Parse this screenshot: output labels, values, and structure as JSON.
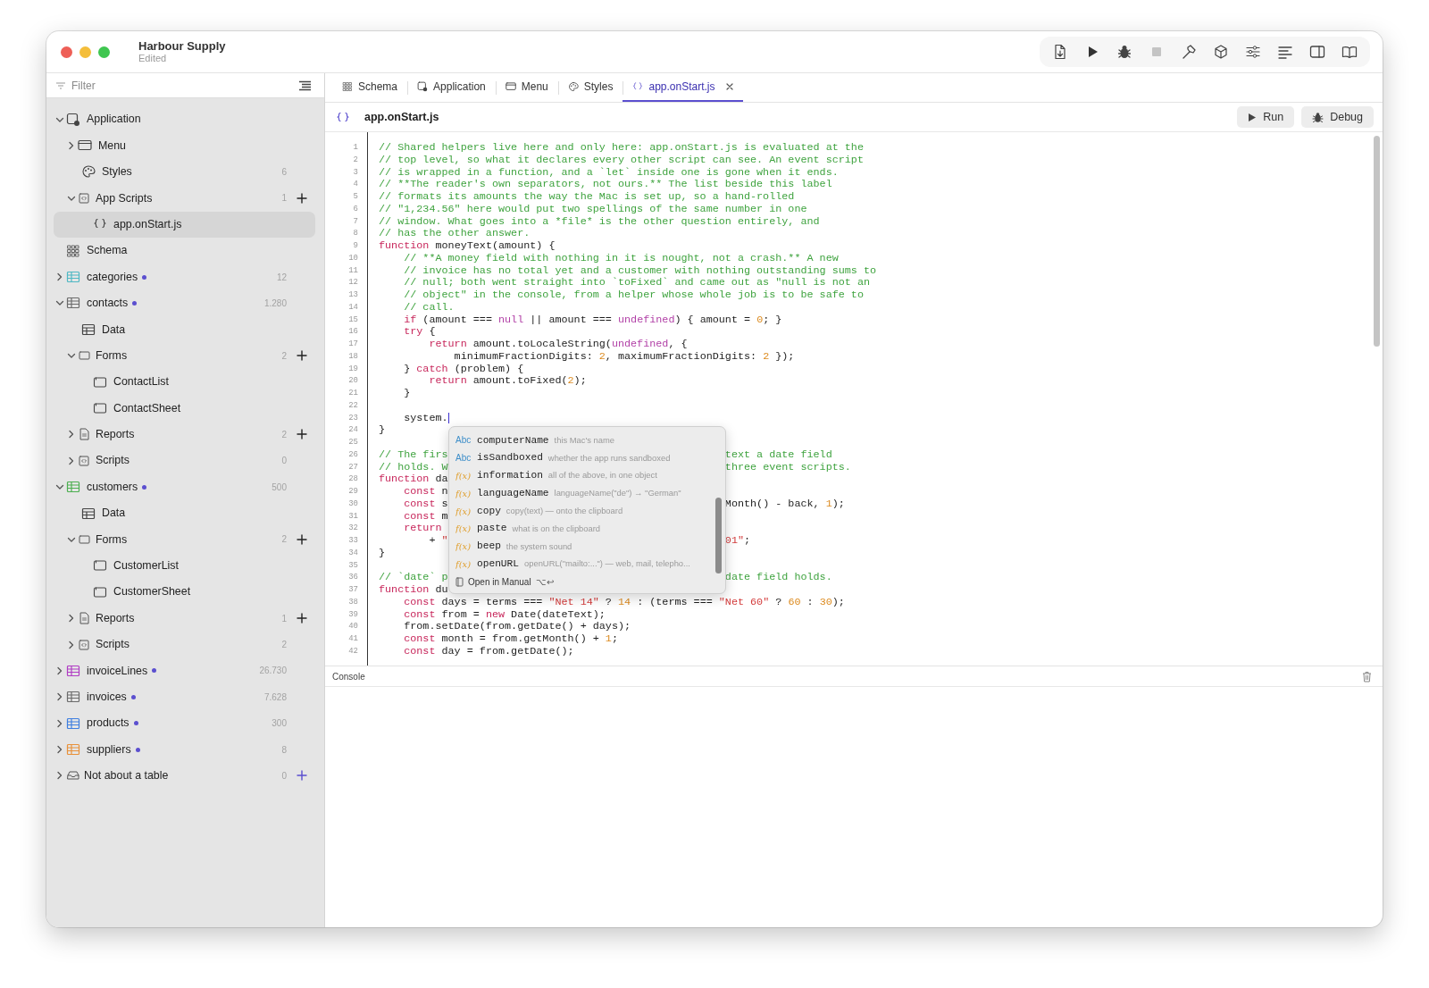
{
  "window": {
    "title": "Harbour Supply",
    "subtitle": "Edited"
  },
  "sidebar": {
    "filter": {
      "placeholder": "Filter"
    },
    "items": [
      {
        "label": "Application",
        "kind": "app",
        "expanded": true,
        "children": [
          {
            "label": "Menu",
            "kind": "window",
            "expanded": false
          },
          {
            "label": "Styles",
            "kind": "palette",
            "count": "6"
          },
          {
            "label": "App Scripts",
            "kind": "scripts",
            "expanded": true,
            "count": "1",
            "add": true,
            "children": [
              {
                "label": "app.onStart.js",
                "kind": "braces",
                "selected": true
              }
            ]
          }
        ]
      },
      {
        "label": "Schema",
        "kind": "schema"
      },
      {
        "label": "categories",
        "kind": "table",
        "color": "#4fb8c4",
        "unsaved": true,
        "expanded": false,
        "count": "12"
      },
      {
        "label": "contacts",
        "kind": "table",
        "color": "#6b6b6b",
        "unsaved": true,
        "expanded": true,
        "count": "1.280",
        "children": [
          {
            "label": "Data",
            "kind": "data"
          },
          {
            "label": "Forms",
            "kind": "folder",
            "expanded": true,
            "count": "2",
            "add": true,
            "children": [
              {
                "label": "ContactList",
                "kind": "form"
              },
              {
                "label": "ContactSheet",
                "kind": "form"
              }
            ]
          },
          {
            "label": "Reports",
            "kind": "report",
            "expanded": false,
            "count": "2",
            "add": true
          },
          {
            "label": "Scripts",
            "kind": "scripts",
            "expanded": false,
            "count": "0"
          }
        ]
      },
      {
        "label": "customers",
        "kind": "table",
        "color": "#4caf50",
        "unsaved": true,
        "expanded": true,
        "count": "500",
        "children": [
          {
            "label": "Data",
            "kind": "data"
          },
          {
            "label": "Forms",
            "kind": "folder",
            "expanded": true,
            "count": "2",
            "add": true,
            "children": [
              {
                "label": "CustomerList",
                "kind": "form"
              },
              {
                "label": "CustomerSheet",
                "kind": "form"
              }
            ]
          },
          {
            "label": "Reports",
            "kind": "report",
            "expanded": false,
            "count": "1",
            "add": true
          },
          {
            "label": "Scripts",
            "kind": "scripts",
            "expanded": false,
            "count": "2"
          }
        ]
      },
      {
        "label": "invoiceLines",
        "kind": "table",
        "color": "#b03cc4",
        "unsaved": true,
        "expanded": false,
        "count": "26.730"
      },
      {
        "label": "invoices",
        "kind": "table",
        "color": "#6b6b6b",
        "unsaved": true,
        "expanded": false,
        "count": "7.628"
      },
      {
        "label": "products",
        "kind": "table",
        "color": "#3f7fe0",
        "unsaved": true,
        "expanded": false,
        "count": "300"
      },
      {
        "label": "suppliers",
        "kind": "table",
        "color": "#e8913a",
        "unsaved": true,
        "expanded": false,
        "count": "8"
      },
      {
        "label": "Not about a table",
        "kind": "tray",
        "expanded": false,
        "count": "0",
        "add": true,
        "add_accent": true
      }
    ]
  },
  "tabs": [
    {
      "label": "Schema",
      "kind": "schema",
      "selected": false
    },
    {
      "label": "Application",
      "kind": "app",
      "selected": false
    },
    {
      "label": "Menu",
      "kind": "window",
      "selected": false
    },
    {
      "label": "Styles",
      "kind": "palette",
      "selected": false
    },
    {
      "label": "app.onStart.js",
      "kind": "braces",
      "selected": true,
      "closable": true
    }
  ],
  "editor": {
    "file": "app.onStart.js",
    "buttons": [
      {
        "label": "Run",
        "kind": "run"
      },
      {
        "label": "Debug",
        "kind": "debug"
      }
    ],
    "lines": [
      {
        "num": "1",
        "tokens": [
          {
            "kind": "comment",
            "text": "// Shared helpers live here and only here: app.onStart.js is evaluated at the"
          }
        ]
      },
      {
        "num": "2",
        "tokens": [
          {
            "kind": "comment",
            "text": "// top level, so what it declares every other script can see. An event script"
          }
        ]
      },
      {
        "num": "3",
        "tokens": [
          {
            "kind": "comment",
            "text": "// is wrapped in a function, and a `let` inside one is gone when it ends."
          }
        ]
      },
      {
        "num": "4",
        "tokens": [
          {
            "kind": "comment",
            "text": "// **The reader's own separators, not ours.** The list beside this label"
          }
        ]
      },
      {
        "num": "5",
        "tokens": [
          {
            "kind": "comment",
            "text": "// formats its amounts the way the Mac is set up, so a hand-rolled"
          }
        ]
      },
      {
        "num": "6",
        "tokens": [
          {
            "kind": "comment",
            "text": "// \"1,234.56\" here would put two spellings of the same number in one"
          }
        ]
      },
      {
        "num": "7",
        "tokens": [
          {
            "kind": "comment",
            "text": "// window. What goes into a *file* is the other question entirely, and"
          }
        ]
      },
      {
        "num": "8",
        "tokens": [
          {
            "kind": "comment",
            "text": "// has the other answer."
          }
        ]
      },
      {
        "num": "9",
        "tokens": [
          {
            "kind": "keyword",
            "text": "function"
          },
          {
            "kind": "plain",
            "text": " moneyText(amount) {"
          }
        ]
      },
      {
        "num": "10",
        "tokens": [
          {
            "kind": "comment",
            "text": "    // **A money field with nothing in it is nought, not a crash.** A new"
          }
        ]
      },
      {
        "num": "11",
        "tokens": [
          {
            "kind": "comment",
            "text": "    // invoice has no total yet and a customer with nothing outstanding sums to"
          }
        ]
      },
      {
        "num": "12",
        "tokens": [
          {
            "kind": "comment",
            "text": "    // null; both went straight into `toFixed` and came out as \"null is not an"
          }
        ]
      },
      {
        "num": "13",
        "tokens": [
          {
            "kind": "comment",
            "text": "    // object\" in the console, from a helper whose whole job is to be safe to"
          }
        ]
      },
      {
        "num": "14",
        "tokens": [
          {
            "kind": "comment",
            "text": "    // call."
          }
        ]
      },
      {
        "num": "15",
        "tokens": [
          {
            "kind": "keyword",
            "text": "    if"
          },
          {
            "kind": "plain",
            "text": " (amount === "
          },
          {
            "kind": "value",
            "text": "null"
          },
          {
            "kind": "plain",
            "text": " || amount === "
          },
          {
            "kind": "value",
            "text": "undefined"
          },
          {
            "kind": "plain",
            "text": ") { amount = "
          },
          {
            "kind": "number",
            "text": "0"
          },
          {
            "kind": "plain",
            "text": "; }"
          }
        ]
      },
      {
        "num": "16",
        "tokens": [
          {
            "kind": "keyword",
            "text": "    try"
          },
          {
            "kind": "plain",
            "text": " {"
          }
        ]
      },
      {
        "num": "17",
        "tokens": [
          {
            "kind": "keyword",
            "text": "        return"
          },
          {
            "kind": "plain",
            "text": " amount.toLocaleString("
          },
          {
            "kind": "value",
            "text": "undefined"
          },
          {
            "kind": "plain",
            "text": ", {"
          }
        ]
      },
      {
        "num": "18",
        "tokens": [
          {
            "kind": "plain",
            "text": "            minimumFractionDigits: "
          },
          {
            "kind": "number",
            "text": "2"
          },
          {
            "kind": "plain",
            "text": ", maximumFractionDigits: "
          },
          {
            "kind": "number",
            "text": "2"
          },
          {
            "kind": "plain",
            "text": " });"
          }
        ]
      },
      {
        "num": "19",
        "tokens": [
          {
            "kind": "plain",
            "text": "    } "
          },
          {
            "kind": "keyword",
            "text": "catch"
          },
          {
            "kind": "plain",
            "text": " (problem) {"
          }
        ]
      },
      {
        "num": "20",
        "tokens": [
          {
            "kind": "keyword",
            "text": "        return"
          },
          {
            "kind": "plain",
            "text": " amount.toFixed("
          },
          {
            "kind": "number",
            "text": "2"
          },
          {
            "kind": "plain",
            "text": ");"
          }
        ]
      },
      {
        "num": "21",
        "tokens": [
          {
            "kind": "plain",
            "text": "    }"
          }
        ]
      },
      {
        "num": "22"
      },
      {
        "num": "23",
        "tokens": [
          {
            "kind": "plain",
            "text": "    system."
          }
        ],
        "cursor": true
      },
      {
        "num": "24",
        "tokens": [
          {
            "kind": "plain",
            "text": "}"
          }
        ]
      },
      {
        "num": "25"
      },
      {
        "num": "26",
        "tokens": [
          {
            "kind": "comment",
            "text": "// The firs"
          }
        ],
        "after_popup": [
          {
            "kind": "comment",
            "text": "text a date field"
          }
        ]
      },
      {
        "num": "27",
        "tokens": [
          {
            "kind": "comment",
            "text": "// holds. W"
          }
        ],
        "after_popup": [
          {
            "kind": "comment",
            "text": "three event scripts."
          }
        ]
      },
      {
        "num": "28",
        "tokens": [
          {
            "kind": "keyword",
            "text": "function"
          },
          {
            "kind": "plain",
            "text": " da"
          }
        ]
      },
      {
        "num": "29",
        "tokens": [
          {
            "kind": "keyword",
            "text": "    const"
          },
          {
            "kind": "plain",
            "text": " n"
          }
        ]
      },
      {
        "num": "30",
        "tokens": [
          {
            "kind": "keyword",
            "text": "    const"
          },
          {
            "kind": "plain",
            "text": " s"
          }
        ],
        "after_popup": [
          {
            "kind": "plain",
            "text": "Month() - back, "
          },
          {
            "kind": "number",
            "text": "1"
          },
          {
            "kind": "plain",
            "text": ");"
          }
        ]
      },
      {
        "num": "31",
        "tokens": [
          {
            "kind": "keyword",
            "text": "    const"
          },
          {
            "kind": "plain",
            "text": " m"
          }
        ]
      },
      {
        "num": "32",
        "tokens": [
          {
            "kind": "keyword",
            "text": "    return"
          }
        ]
      },
      {
        "num": "33",
        "tokens": [
          {
            "kind": "plain",
            "text": "        + "
          },
          {
            "kind": "string",
            "text": "\""
          }
        ],
        "after_popup": [
          {
            "kind": "string",
            "text": "01\""
          },
          {
            "kind": "plain",
            "text": ";"
          }
        ]
      },
      {
        "num": "34",
        "tokens": [
          {
            "kind": "plain",
            "text": "}"
          }
        ]
      },
      {
        "num": "35"
      },
      {
        "num": "36",
        "tokens": [
          {
            "kind": "comment",
            "text": "// `date` p"
          }
        ],
        "after_popup": [
          {
            "kind": "comment",
            "text": "date field holds."
          }
        ]
      },
      {
        "num": "37",
        "tokens": [
          {
            "kind": "keyword",
            "text": "function"
          },
          {
            "kind": "plain",
            "text": " du"
          }
        ]
      },
      {
        "num": "38",
        "tokens": [
          {
            "kind": "keyword",
            "text": "    const"
          },
          {
            "kind": "plain",
            "text": " days = terms === "
          },
          {
            "kind": "string",
            "text": "\"Net 14\""
          },
          {
            "kind": "plain",
            "text": " ? "
          },
          {
            "kind": "number",
            "text": "14"
          },
          {
            "kind": "plain",
            "text": " : (terms === "
          },
          {
            "kind": "string",
            "text": "\"Net 60\""
          },
          {
            "kind": "plain",
            "text": " ? "
          },
          {
            "kind": "number",
            "text": "60"
          },
          {
            "kind": "plain",
            "text": " : "
          },
          {
            "kind": "number",
            "text": "30"
          },
          {
            "kind": "plain",
            "text": ");"
          }
        ]
      },
      {
        "num": "39",
        "tokens": [
          {
            "kind": "keyword",
            "text": "    const"
          },
          {
            "kind": "plain",
            "text": " from = "
          },
          {
            "kind": "keyword",
            "text": "new"
          },
          {
            "kind": "plain",
            "text": " Date(dateText);"
          }
        ]
      },
      {
        "num": "40",
        "tokens": [
          {
            "kind": "plain",
            "text": "    from.setDate(from.getDate() + days);"
          }
        ]
      },
      {
        "num": "41",
        "tokens": [
          {
            "kind": "keyword",
            "text": "    const"
          },
          {
            "kind": "plain",
            "text": " month = from.getMonth() + "
          },
          {
            "kind": "number",
            "text": "1"
          },
          {
            "kind": "plain",
            "text": ";"
          }
        ]
      },
      {
        "num": "42",
        "tokens": [
          {
            "kind": "keyword",
            "text": "    const"
          },
          {
            "kind": "plain",
            "text": " day = from.getDate();"
          }
        ]
      }
    ],
    "completion": {
      "items": [
        {
          "kind": "property",
          "icon_text": "Abc",
          "name": "computerName",
          "hint": "this Mac's name"
        },
        {
          "kind": "property",
          "icon_text": "Abc",
          "name": "isSandboxed",
          "hint": "whether the app runs sandboxed"
        },
        {
          "kind": "function",
          "icon_text": "f(x)",
          "name": "information",
          "hint": "all of the above, in one object"
        },
        {
          "kind": "function",
          "icon_text": "f(x)",
          "name": "languageName",
          "hint": "languageName(\"de\") → \"German\""
        },
        {
          "kind": "function",
          "icon_text": "f(x)",
          "name": "copy",
          "hint": "copy(text) — onto the clipboard"
        },
        {
          "kind": "function",
          "icon_text": "f(x)",
          "name": "paste",
          "hint": "what is on the clipboard"
        },
        {
          "kind": "function",
          "icon_text": "f(x)",
          "name": "beep",
          "hint": "the system sound"
        },
        {
          "kind": "function",
          "icon_text": "f(x)",
          "name": "openURL",
          "hint": "openURL(\"mailto:...\") — web, mail, telepho..."
        }
      ],
      "footer": "Open in Manual",
      "shortcut": "⌥↩"
    }
  },
  "console": {
    "title": "Console"
  }
}
